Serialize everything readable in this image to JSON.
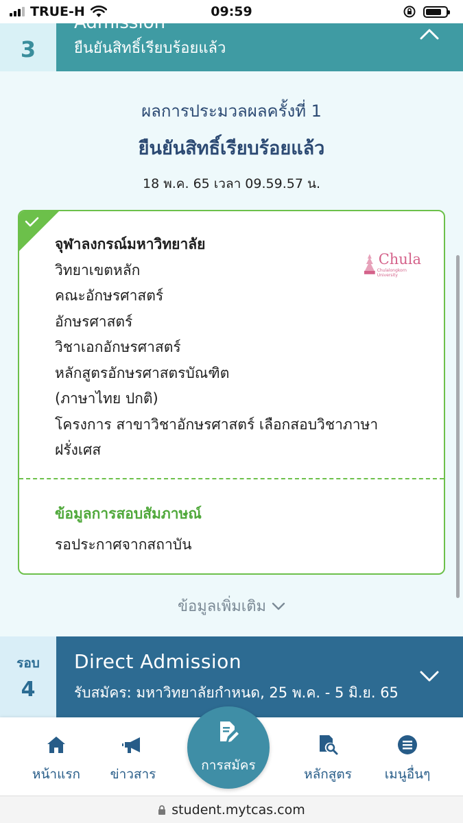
{
  "status_bar": {
    "carrier": "TRUE-H",
    "time": "09:59"
  },
  "round3": {
    "number": "3",
    "title_cut": "Admission",
    "subtitle": "ยืนยันสิทธิ์เรียบร้อยแล้ว"
  },
  "result": {
    "round_label": "ผลการประมวลผลครั้งที่ 1",
    "status": "ยืนยันสิทธิ์เรียบร้อยแล้ว",
    "timestamp": "18 พ.ค. 65 เวลา 09.59.57 น."
  },
  "card": {
    "university": "จุฬาลงกรณ์มหาวิทยาลัย",
    "details": [
      "วิทยาเขตหลัก",
      "คณะอักษรศาสตร์",
      "อักษรศาสตร์",
      "วิชาเอกอักษรศาสตร์",
      "หลักสูตรอักษรศาสตรบัณฑิต",
      "(ภาษาไทย ปกติ)",
      "โครงการ สาขาวิชาอักษรศาสตร์ เลือกสอบวิชาภาษา",
      "ฝรั่งเศส"
    ],
    "logo_text": "Chula",
    "logo_subtext": "Chulalongkorn University",
    "interview_title": "ข้อมูลการสอบสัมภาษณ์",
    "interview_value": "รอประกาศจากสถาบัน",
    "accent_color": "#6cc04a"
  },
  "more_info_label": "ข้อมูลเพิ่มเติม",
  "round4": {
    "label": "รอบ",
    "number": "4",
    "title": "Direct Admission",
    "dates": "รับสมัคร: มหาวิทยาลัยกำหนด, 25 พ.ค. - 5 มิ.ย. 65"
  },
  "nav": {
    "home": "หน้าแรก",
    "news": "ข่าวสาร",
    "apply": "การสมัคร",
    "courses": "หลักสูตร",
    "more": "เมนูอื่นๆ"
  },
  "url": "student.mytcas.com"
}
